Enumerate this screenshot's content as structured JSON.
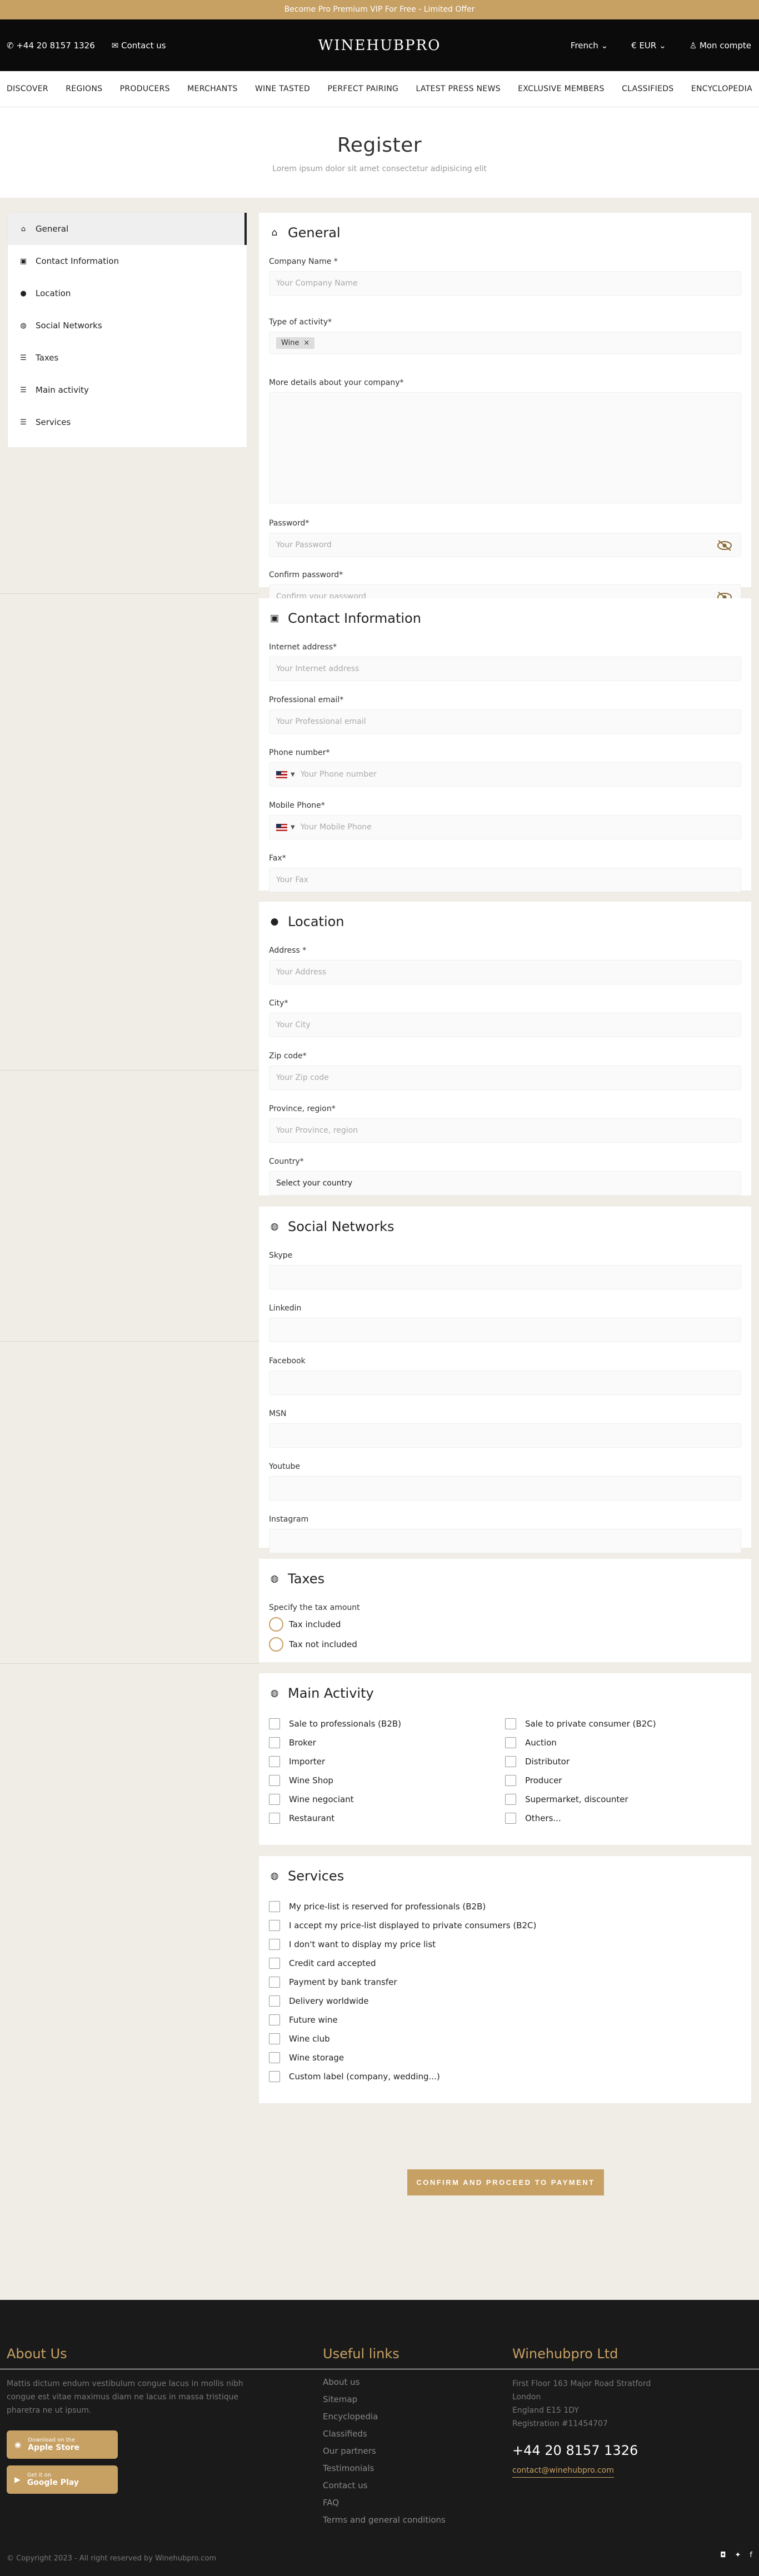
{
  "topbar": {
    "promo": "Become Pro Premium VIP For Free - Limited Offer"
  },
  "header": {
    "phone": "+44 20 8157 1326",
    "contact": "Contact us",
    "logo": "WINEHUBPRO",
    "language": "French",
    "currency": "€ EUR",
    "account": "Mon compte"
  },
  "nav": [
    "DISCOVER",
    "REGIONS",
    "PRODUCERS",
    "MERCHANTS",
    "WINE TASTED",
    "PERFECT PAIRING",
    "LATEST PRESS NEWS",
    "EXCLUSIVE MEMBERS",
    "CLASSIFIEDS",
    "ENCYCLOPEDIA"
  ],
  "hero": {
    "title": "Register",
    "subtitle": "Lorem ipsum dolor sit amet consectetur adipisicing elit"
  },
  "sidebar": [
    {
      "label": "General",
      "icon": "home-icon"
    },
    {
      "label": "Contact Information",
      "icon": "contact-card-icon"
    },
    {
      "label": "Location",
      "icon": "map-pin-icon"
    },
    {
      "label": "Social Networks",
      "icon": "globe-icon"
    },
    {
      "label": "Taxes",
      "icon": "list-icon"
    },
    {
      "label": "Main activity",
      "icon": "list-icon"
    },
    {
      "label": "Services",
      "icon": "list-icon"
    }
  ],
  "general": {
    "title": "General",
    "company_label": "Company Name *",
    "company_placeholder": "Your Company Name",
    "activity_label": "Type of activity*",
    "activity_chip": "Wine",
    "details_label": "More details about your company*",
    "password_label": "Password*",
    "password_placeholder": "Your Password",
    "confirm_label": "Confirm password*",
    "confirm_placeholder": "Confirm your password"
  },
  "contact": {
    "title": "Contact Information",
    "internet_label": "Internet address*",
    "internet_placeholder": "Your Internet address",
    "email_label": "Professional email*",
    "email_placeholder": "Your Professional email",
    "phone_label": "Phone number*",
    "phone_placeholder": "Your Phone number",
    "mobile_label": "Mobile Phone*",
    "mobile_placeholder": "Your Mobile Phone",
    "fax_label": "Fax*",
    "fax_placeholder": "Your Fax"
  },
  "location": {
    "title": "Location",
    "address_label": "Address *",
    "address_placeholder": "Your Address",
    "city_label": "City*",
    "city_placeholder": "Your City",
    "zip_label": "Zip code*",
    "zip_placeholder": "Your Zip code",
    "province_label": "Province, region*",
    "province_placeholder": "Your Province, region",
    "country_label": "Country*",
    "country_placeholder": "Select your country"
  },
  "social": {
    "title": "Social Networks",
    "fields": [
      "Skype",
      "Linkedin",
      "Facebook",
      "MSN",
      "Youtube",
      "Instagram"
    ]
  },
  "taxes": {
    "title": "Taxes",
    "question": "Specify the tax amount",
    "options": [
      "Tax included",
      "Tax not included"
    ]
  },
  "activity": {
    "title": "Main Activity",
    "left": [
      "Sale to professionals (B2B)",
      "Broker",
      "Importer",
      "Wine Shop",
      "Wine negociant",
      "Restaurant"
    ],
    "right": [
      "Sale to private consumer (B2C)",
      "Auction",
      "Distributor",
      "Producer",
      "Supermarket, discounter",
      "Others..."
    ]
  },
  "services": {
    "title": "Services",
    "items": [
      "My price-list is reserved for professionals (B2B)",
      "I accept my price-list displayed to private consumers (B2C)",
      "I don't want to display my price list",
      "Credit card accepted",
      "Payment by bank transfer",
      "Delivery worldwide",
      "Future wine",
      "Wine club",
      "Wine storage",
      "Custom label (company, wedding...)"
    ]
  },
  "submit": "CONFIRM AND PROCEED TO PAYMENT",
  "footer": {
    "about_title": "About Us",
    "about_text": "Mattis dictum endum vestibulum congue lacus in mollis nibh congue est vitae maximus diam ne lacus in massa tristique pharetra ne ut ipsum.",
    "apple_small": "Download on the",
    "apple_big": "Apple Store",
    "google_small": "Get it on",
    "google_big": "Google Play",
    "links_title": "Useful links",
    "links": [
      "About us",
      "Sitemap",
      "Encyclopedia",
      "Classifieds",
      "Our partners",
      "Testimonials",
      "Contact us",
      "FAQ",
      "Terms and general conditions"
    ],
    "company_title": "Winehubpro Ltd",
    "address": [
      "First Floor 163 Major Road Stratford",
      "London",
      "England E15 1DY",
      "Registration #11454707"
    ],
    "phone": "+44 20 8157 1326",
    "email": "contact@winehubpro.com",
    "copyright": "© Copyright 2023 - All right reserved by Winehubpro.com"
  }
}
